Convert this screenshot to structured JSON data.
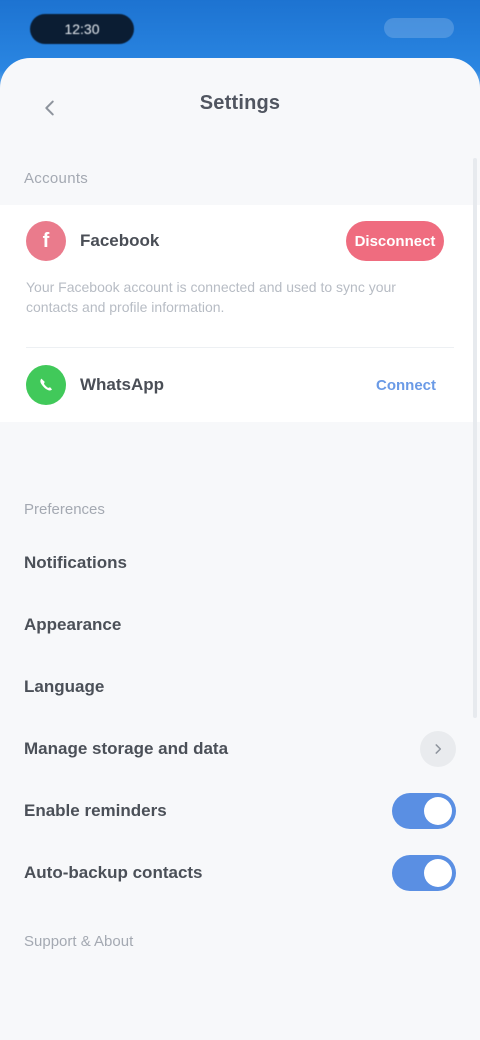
{
  "status_bar": {
    "time": "12:30"
  },
  "nav": {
    "title": "Settings"
  },
  "connected_accounts": {
    "header": "Accounts",
    "facebook": {
      "name": "Facebook",
      "action_label": "Disconnect",
      "description": "Your Facebook account is connected and used to sync your contacts and profile information."
    },
    "whatsapp": {
      "name": "WhatsApp",
      "action_label": "Connect"
    }
  },
  "preferences": {
    "header": "Preferences",
    "items": [
      {
        "label": "Notifications",
        "control": "none"
      },
      {
        "label": "Appearance",
        "control": "none"
      },
      {
        "label": "Language",
        "control": "none"
      },
      {
        "label": "Manage storage and data",
        "control": "chevron"
      },
      {
        "label": "Enable reminders",
        "control": "toggle",
        "on": true
      },
      {
        "label": "Auto-backup contacts",
        "control": "toggle",
        "on": true
      }
    ]
  },
  "support": {
    "header": "Support & About"
  },
  "colors": {
    "accent": "#5a8fe3",
    "facebook": "#ea7b8c",
    "whatsapp": "#41c95a",
    "danger": "#ef6c7f"
  }
}
